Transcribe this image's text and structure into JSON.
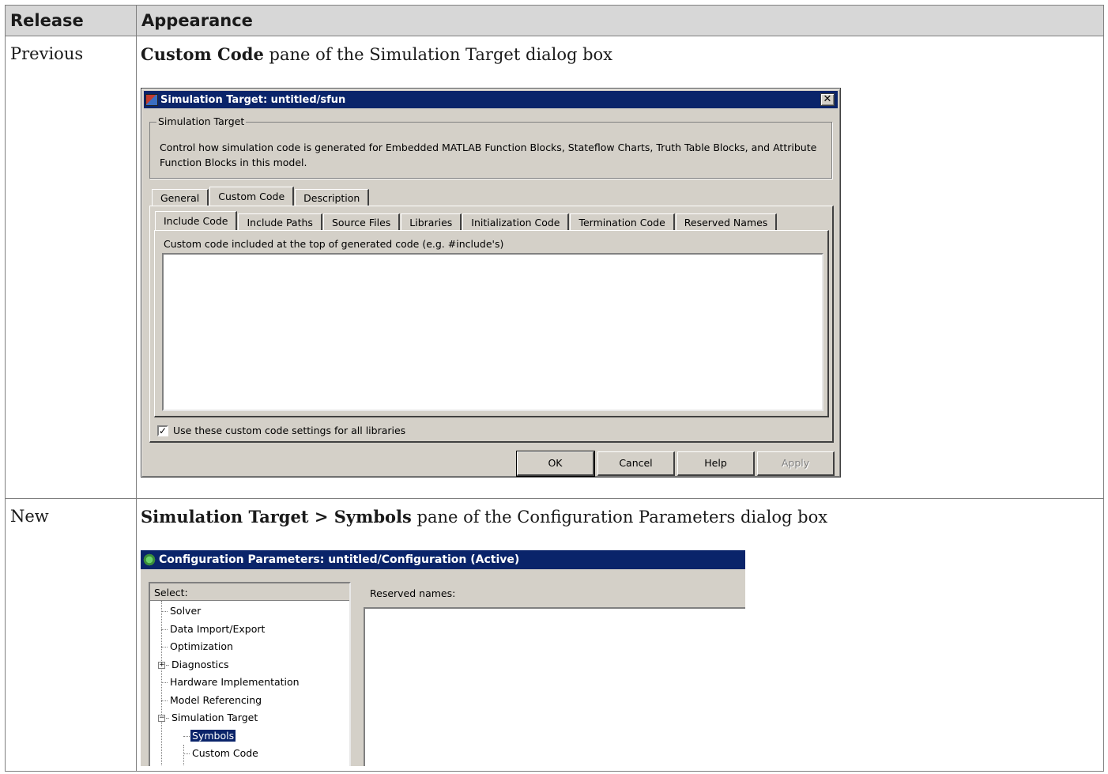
{
  "table": {
    "headers": [
      "Release",
      "Appearance"
    ],
    "rows": [
      {
        "release": "Previous",
        "caption_bold": "Custom Code",
        "caption_rest": "pane of the Simulation Target dialog box"
      },
      {
        "release": "New",
        "caption_bold": "Simulation Target > Symbols",
        "caption_rest": "pane of the Configuration Parameters dialog box"
      }
    ]
  },
  "dialog1": {
    "title": "Simulation Target: untitled/sfun",
    "close_glyph": "✕",
    "group_title": "Simulation Target",
    "group_description": "Control how simulation code is generated for Embedded MATLAB Function Blocks, Stateflow Charts, Truth Table Blocks, and Attribute Function Blocks in this model.",
    "tabs": [
      "General",
      "Custom Code",
      "Description"
    ],
    "active_tab": "Custom Code",
    "subtabs": [
      "Include Code",
      "Include Paths",
      "Source Files",
      "Libraries",
      "Initialization Code",
      "Termination Code",
      "Reserved Names"
    ],
    "active_subtab": "Include Code",
    "code_label": "Custom code included at the top of generated code (e.g. #include's)",
    "code_value": "",
    "checkbox_label": "Use these custom code settings for all libraries",
    "checkbox_checked": true,
    "checkbox_glyph": "✓",
    "buttons": {
      "ok": "OK",
      "cancel": "Cancel",
      "help": "Help",
      "apply": "Apply"
    }
  },
  "dialog2": {
    "title": "Configuration Parameters: untitled/Configuration (Active)",
    "select_label": "Select:",
    "tree": [
      {
        "label": "Solver",
        "level": 0,
        "expander": ""
      },
      {
        "label": "Data Import/Export",
        "level": 0,
        "expander": ""
      },
      {
        "label": "Optimization",
        "level": 0,
        "expander": ""
      },
      {
        "label": "Diagnostics",
        "level": 0,
        "expander": "+"
      },
      {
        "label": "Hardware Implementation",
        "level": 0,
        "expander": ""
      },
      {
        "label": "Model Referencing",
        "level": 0,
        "expander": ""
      },
      {
        "label": "Simulation Target",
        "level": 0,
        "expander": "−"
      },
      {
        "label": "Symbols",
        "level": 1,
        "expander": "",
        "selected": true
      },
      {
        "label": "Custom Code",
        "level": 1,
        "expander": ""
      }
    ],
    "reserved_label": "Reserved names:",
    "reserved_value": ""
  },
  "colors": {
    "header_bg": "#d7d7d7",
    "dialog_face": "#d4d0c8",
    "titlebar": "#0a246a",
    "selection": "#0a246a"
  }
}
